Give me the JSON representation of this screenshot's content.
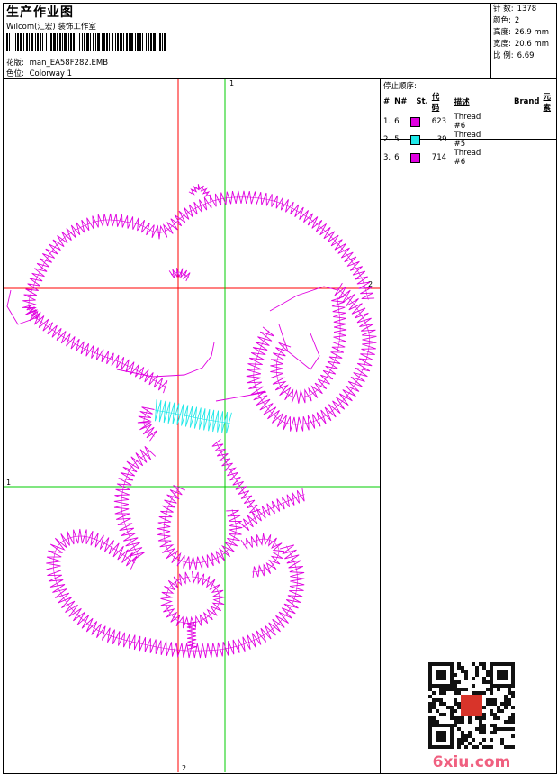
{
  "header": {
    "title": "生产作业图",
    "studio": "Wilcom(汇宏) 装饰工作室",
    "design_label": "花版:",
    "design_name": "man_EA58F282.EMB",
    "colorway_label": "色位:",
    "colorway_name": "Colorway 1"
  },
  "stats": [
    {
      "label": "针 数:",
      "value": "1378"
    },
    {
      "label": "颜色:",
      "value": "2"
    },
    {
      "label": "高度:",
      "value": "26.9 mm"
    },
    {
      "label": "宽度:",
      "value": "20.6 mm"
    },
    {
      "label": "比 例:",
      "value": "6.69"
    }
  ],
  "stop_sequence": {
    "label": "停止顺序:",
    "columns": [
      "#",
      "N#",
      "St.",
      "代码",
      "描述",
      "Brand",
      "元素"
    ],
    "rows": [
      {
        "index": "1.",
        "needle": "6",
        "color": "#e000e0",
        "code": "623",
        "desc": "Thread #6"
      },
      {
        "index": "2.",
        "needle": "5",
        "color": "#20e8e8",
        "code": "39",
        "desc": "Thread #5"
      },
      {
        "index": "3.",
        "needle": "6",
        "color": "#e000e0",
        "code": "714",
        "desc": "Thread #6"
      }
    ]
  },
  "axes": {
    "green_v_label": "1",
    "green_h_label": "1",
    "red_h_label": "2",
    "red_v_label": "2"
  },
  "colors": {
    "stitch_primary": "#e000e0",
    "stitch_secondary": "#20e8e8",
    "axis_red": "#ff0000",
    "axis_green": "#00cc00"
  },
  "watermark": {
    "text": "6xiu.com"
  }
}
